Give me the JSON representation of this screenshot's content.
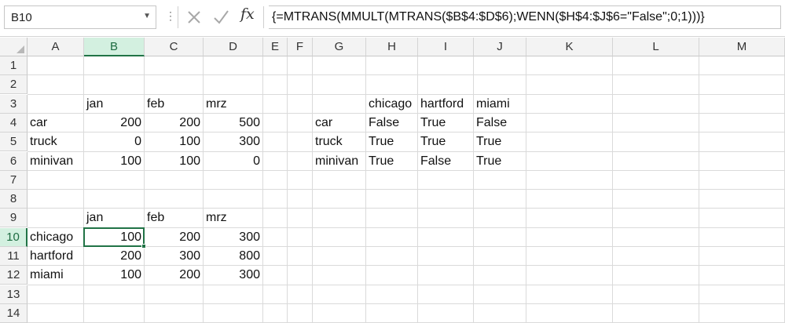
{
  "name_box": "B10",
  "formula_bar": {
    "fx_label": "fx",
    "formula": "{=MTRANS(MMULT(MTRANS($B$4:$D$6);WENN($H$4:$J$6=\"False\";0;1)))}"
  },
  "columns": [
    "A",
    "B",
    "C",
    "D",
    "E",
    "F",
    "G",
    "H",
    "I",
    "J",
    "K",
    "L",
    "M"
  ],
  "rows": [
    "1",
    "2",
    "3",
    "4",
    "5",
    "6",
    "7",
    "8",
    "9",
    "10",
    "11",
    "12",
    "13",
    "14"
  ],
  "active_cell": {
    "column": "B",
    "row": "10"
  },
  "cells": {
    "B3": "jan",
    "C3": "feb",
    "D3": "mrz",
    "A4": "car",
    "B4": "200",
    "C4": "200",
    "D4": "500",
    "A5": "truck",
    "B5": "0",
    "C5": "100",
    "D5": "300",
    "A6": "minivan",
    "B6": "100",
    "C6": "100",
    "D6": "0",
    "H3": "chicago",
    "I3": "hartford",
    "J3": "miami",
    "G4": "car",
    "H4": "False",
    "I4": "True",
    "J4": "False",
    "G5": "truck",
    "H5": "True",
    "I5": "True",
    "J5": "True",
    "G6": "minivan",
    "H6": "True",
    "I6": "False",
    "J6": "True",
    "B9": "jan",
    "C9": "feb",
    "D9": "mrz",
    "A10": "chicago",
    "B10": "100",
    "C10": "200",
    "D10": "300",
    "A11": "hartford",
    "B11": "200",
    "C11": "300",
    "D11": "800",
    "A12": "miami",
    "B12": "100",
    "C12": "200",
    "D12": "300"
  },
  "colors": {
    "accent": "#217346",
    "header_bg": "#f3f3f3",
    "active_header_bg": "#d3f0e0"
  }
}
